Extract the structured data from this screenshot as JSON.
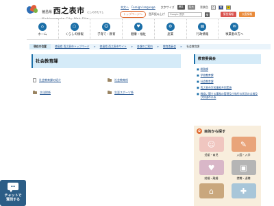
{
  "header": {
    "prefecture": "徳島県",
    "city": "西之表市",
    "city_sub": "にしのおもてし",
    "city_en": "Nishinoomote City Web Site",
    "util": {
      "sitemap": "本文へ",
      "foreign": "Foreign language",
      "font_size_label": "文字サイズ",
      "font_std": "標準",
      "font_large": "拡大",
      "color_label": "背景色",
      "swatch_w": "白",
      "swatch_b": "青",
      "swatch_y": "黄"
    },
    "top_button": "トップページへ",
    "voice_label": "音声読み上げ",
    "search_placeholder": "Google 提供",
    "search_go": "検",
    "emergency": "緊急情報",
    "disaster": "災害情報"
  },
  "gnav": [
    {
      "label": "ホーム",
      "icon": "home-icon",
      "glyph": "⌂"
    },
    {
      "label": "くらしの情報",
      "icon": "life-icon",
      "glyph": "☖"
    },
    {
      "label": "子育て・教育",
      "icon": "kids-icon",
      "glyph": "☺"
    },
    {
      "label": "健康・福祉",
      "icon": "health-icon",
      "glyph": "♥"
    },
    {
      "label": "産業",
      "icon": "industry-icon",
      "glyph": "⚙"
    },
    {
      "label": "行政情報",
      "icon": "admin-icon",
      "glyph": "▤"
    },
    {
      "label": "事業者の方へ",
      "icon": "business-icon",
      "glyph": "✉"
    }
  ],
  "breadcrumb": {
    "head": "現在の位置",
    "items": [
      "徳島県 西之表市トップページ",
      "徳島県 西之表市サイト",
      "各課のご案内",
      "教育委員会"
    ],
    "current": "社会教育課"
  },
  "page_title": "社会教育課",
  "links": [
    [
      {
        "label": "社会教育課の紹介",
        "icon": "doc"
      },
      {
        "label": "社会教育係",
        "icon": "folder"
      }
    ],
    [
      {
        "label": "文化財係",
        "icon": "folder"
      },
      {
        "label": "生涯スポーツ係",
        "icon": "folder"
      }
    ]
  ],
  "side": {
    "title": "教育委員会",
    "items": [
      "総務課",
      "学校教育課",
      "社会教育課",
      "西之表市学校事務共同実施",
      "教育に関する事務の管理及び執行の状況の点検及び評価の公表"
    ]
  },
  "purpose": {
    "title": "目的から探す",
    "tiles": [
      {
        "label": "妊娠・育児",
        "color": "#f0c6c0",
        "glyph": "☺"
      },
      {
        "label": "入園・入学",
        "color": "#e9a47a",
        "glyph": "✎"
      },
      {
        "label": "結婚・離婚",
        "color": "#d9b7c8",
        "glyph": "♥"
      },
      {
        "label": "就職・退職",
        "color": "#b5b5b5",
        "glyph": "▣"
      },
      {
        "label": "",
        "color": "#c9a77d",
        "glyph": "⌂"
      },
      {
        "label": "",
        "color": "#a8c6d9",
        "glyph": "✚"
      }
    ]
  },
  "chat": {
    "line1": "チャットで",
    "line2": "質問する",
    "glyph": "…"
  }
}
